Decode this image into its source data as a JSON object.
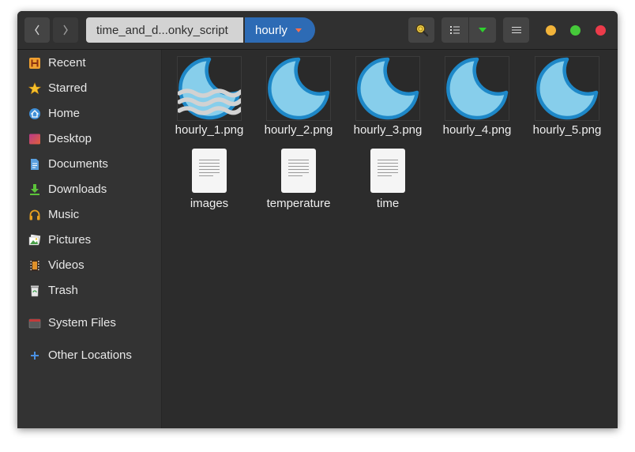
{
  "headerbar": {
    "path_parent": "time_and_d...onky_script",
    "path_current": "hourly"
  },
  "sidebar": {
    "items": [
      {
        "label": "Recent",
        "icon": "recent-icon"
      },
      {
        "label": "Starred",
        "icon": "star-icon"
      },
      {
        "label": "Home",
        "icon": "home-icon"
      },
      {
        "label": "Desktop",
        "icon": "desktop-icon"
      },
      {
        "label": "Documents",
        "icon": "documents-icon"
      },
      {
        "label": "Downloads",
        "icon": "downloads-icon"
      },
      {
        "label": "Music",
        "icon": "music-icon"
      },
      {
        "label": "Pictures",
        "icon": "pictures-icon"
      },
      {
        "label": "Videos",
        "icon": "videos-icon"
      },
      {
        "label": "Trash",
        "icon": "trash-icon"
      },
      {
        "label": "System Files",
        "icon": "drive-icon"
      },
      {
        "label": "Other Locations",
        "icon": "plus-icon"
      }
    ]
  },
  "files": [
    {
      "name": "hourly_1.png",
      "kind": "image",
      "thumbnail": "moon-fog"
    },
    {
      "name": "hourly_2.png",
      "kind": "image",
      "thumbnail": "moon"
    },
    {
      "name": "hourly_3.png",
      "kind": "image",
      "thumbnail": "moon"
    },
    {
      "name": "hourly_4.png",
      "kind": "image",
      "thumbnail": "moon"
    },
    {
      "name": "hourly_5.png",
      "kind": "image",
      "thumbnail": "moon"
    },
    {
      "name": "images",
      "kind": "text-document"
    },
    {
      "name": "temperature",
      "kind": "text-document"
    },
    {
      "name": "time",
      "kind": "text-document"
    }
  ],
  "colors": {
    "accent": "#2d6bb5",
    "moon_fill": "#87ceeb",
    "moon_stroke": "#1e88c8",
    "close": "#ec3b4a",
    "minimize": "#f2b43a",
    "maximize": "#46c93a"
  }
}
